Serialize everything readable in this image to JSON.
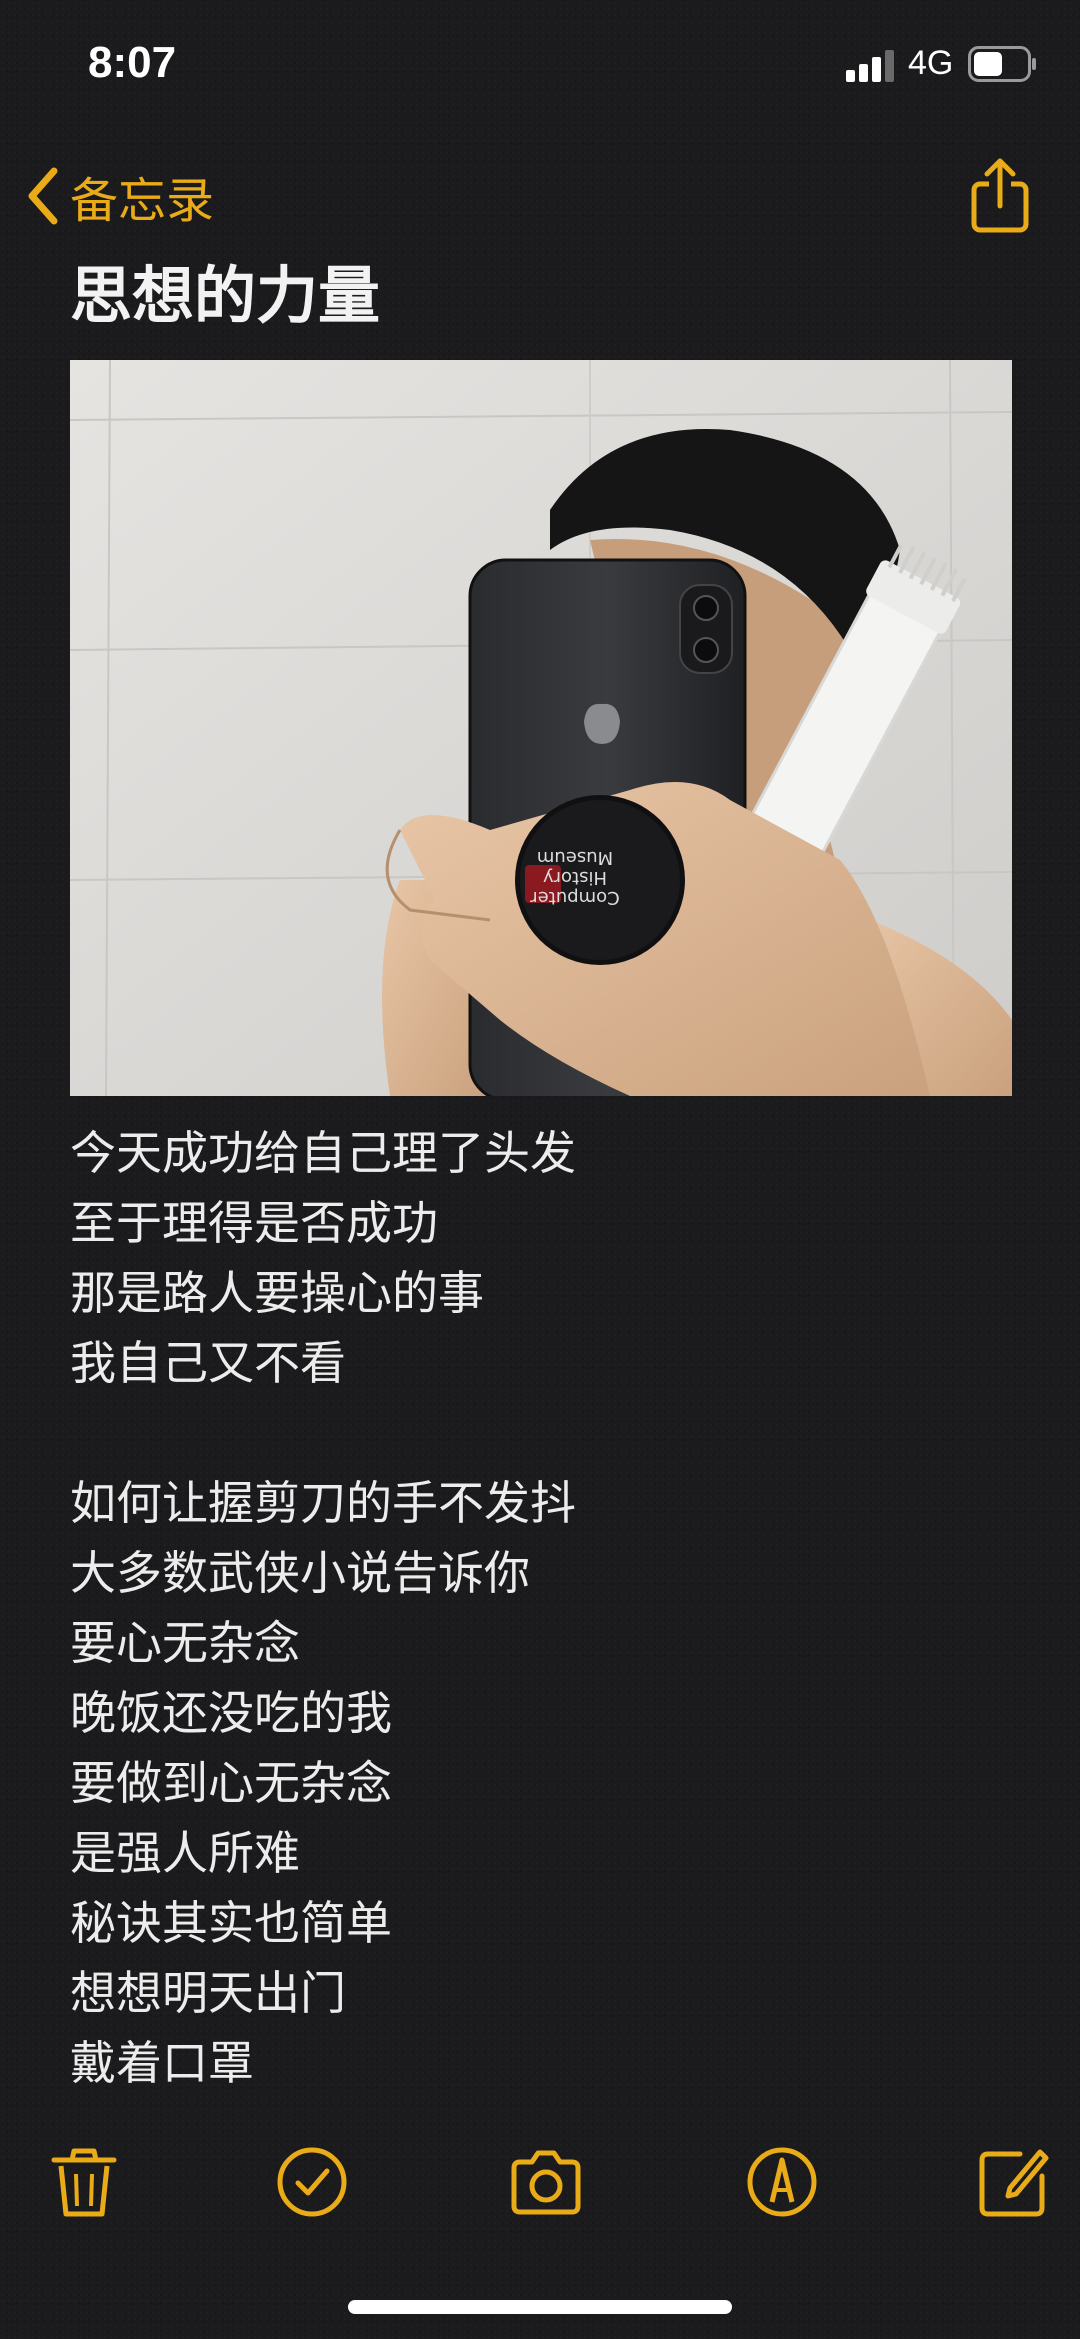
{
  "status_bar": {
    "time": "8:07",
    "network": "4G",
    "signal_icon": "signal-bars-icon",
    "battery_icon": "battery-icon"
  },
  "nav": {
    "back_label": "备忘录",
    "back_icon": "chevron-left-icon",
    "share_icon": "share-icon"
  },
  "note": {
    "title": "思想的力量",
    "image_icon": "photo-attachment",
    "lines": [
      "今天成功给自己理了头发",
      "至于理得是否成功",
      "那是路人要操心的事",
      "我自己又不看",
      "",
      "如何让握剪刀的手不发抖",
      "大多数武侠小说告诉你",
      "要心无杂念",
      "晚饭还没吃的我",
      "要做到心无杂念",
      "是强人所难",
      "秘诀其实也简单",
      "想想明天出门",
      "戴着口罩"
    ]
  },
  "toolbar": {
    "icons": [
      "trash-icon",
      "checklist-icon",
      "camera-icon",
      "markup-icon",
      "compose-icon"
    ]
  },
  "colors": {
    "accent": "#e9ab17",
    "background": "#1b1b1d",
    "text": "#ececec"
  }
}
